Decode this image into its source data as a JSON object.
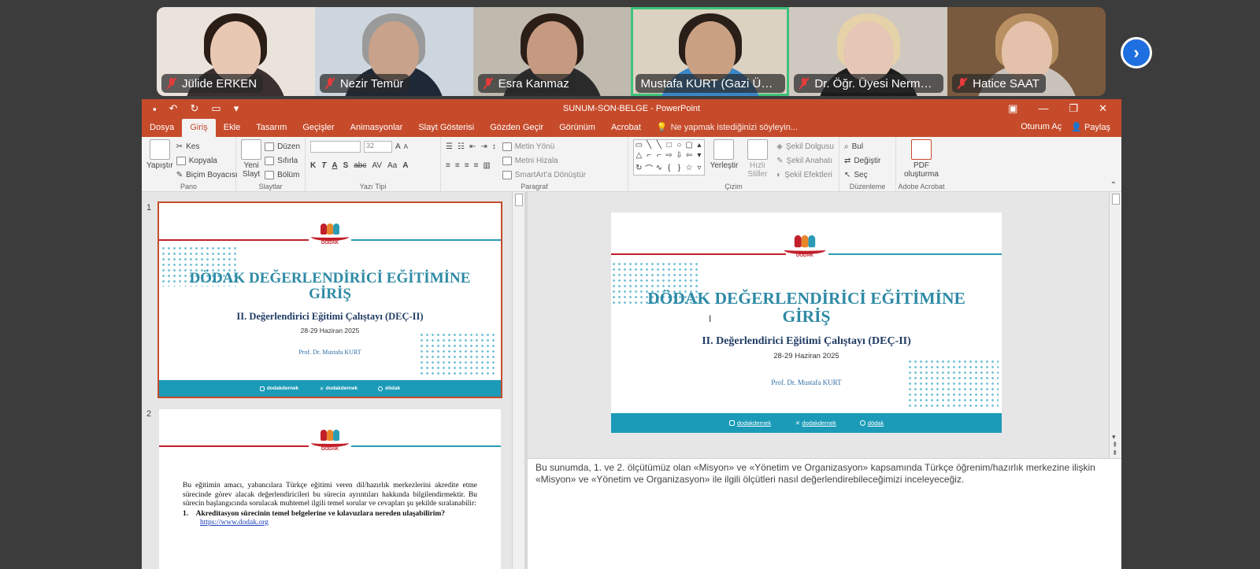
{
  "participants": [
    {
      "name": "Jülide ERKEN",
      "bg": "#e9e3dc",
      "skin": "#e8c7b3",
      "hair": "#2a1d16",
      "shirt": "#3c2f2f",
      "active": false
    },
    {
      "name": "Nezir Temür",
      "bg": "#cdd6de",
      "skin": "#c8a28a",
      "hair": "#9a9a9a",
      "shirt": "#1f2836",
      "active": false
    },
    {
      "name": "Esra Kanmaz",
      "bg": "#bfb9ae",
      "skin": "#c59a80",
      "hair": "#2b1e17",
      "shirt": "#2b2b2b",
      "active": false
    },
    {
      "name": "Mustafa KURT (Gazi Üniversitesi)",
      "bg": "#dcd2c2",
      "skin": "#caa083",
      "hair": "#2a1f18",
      "shirt": "#3a86c6",
      "active": true
    },
    {
      "name": "Dr. Öğr. Üyesi Nerma Özdemir",
      "bg": "#cfc8c0",
      "skin": "#e6c6b4",
      "hair": "#e6d2a8",
      "shirt": "#1b1b1b",
      "active": false
    },
    {
      "name": "Hatice SAAT",
      "bg": "#7a5a3e",
      "skin": "#e3c1aa",
      "hair": "#b99062",
      "shirt": "#c9c3bb",
      "active": false
    }
  ],
  "window": {
    "title": "SUNUM-SON-BELGE - PowerPoint",
    "tabs": [
      "Dosya",
      "Giriş",
      "Ekle",
      "Tasarım",
      "Geçişler",
      "Animasyonlar",
      "Slayt Gösterisi",
      "Gözden Geçir",
      "Görünüm",
      "Acrobat"
    ],
    "active_tab": "Giriş",
    "tell_me": "Ne yapmak istediğinizi söyleyin...",
    "sign_in": "Oturum Aç",
    "share": "Paylaş"
  },
  "ribbon": {
    "pano": {
      "label": "Pano",
      "paste": "Yapıştır",
      "cut": "Kes",
      "copy": "Kopyala",
      "format_painter": "Biçim Boyacısı"
    },
    "slaytlar": {
      "label": "Slaytlar",
      "new_slide_1": "Yeni",
      "new_slide_2": "Slayt",
      "layout": "Düzen",
      "reset": "Sıfırla",
      "section": "Bölüm"
    },
    "yazi_tipi": {
      "label": "Yazı Tipi",
      "font_size": "32",
      "bold": "K",
      "italic": "T",
      "underline": "A",
      "shadow": "S",
      "strike": "abc",
      "spacing": "AV",
      "case": "Aa",
      "color": "A",
      "grow": "A",
      "shrink": "A"
    },
    "paragraf": {
      "label": "Paragraf",
      "text_direction": "Metin Yönü",
      "align_text": "Metni Hizala",
      "smartart": "SmartArt'a Dönüştür"
    },
    "cizim": {
      "label": "Çizim",
      "arrange": "Yerleştir",
      "quick_styles_1": "Hızlı",
      "quick_styles_2": "Stiller",
      "fill": "Şekil Dolgusu",
      "outline": "Şekil Anahatı",
      "effects": "Şekil Efektleri"
    },
    "duzenleme": {
      "label": "Düzenleme",
      "find": "Bul",
      "replace": "Değiştir",
      "select": "Seç"
    },
    "acrobat": {
      "label": "Adobe Acrobat",
      "pdf_1": "PDF",
      "pdf_2": "oluşturma"
    }
  },
  "slide1": {
    "number": "1",
    "title_line1": "DÖDAK DEĞERLENDİRİCİ EĞİTİMİNE",
    "title_line2": "GİRİŞ",
    "subtitle": "II. Değerlendirici Eğitimi Çalıştayı (DEÇ-II)",
    "date": "28-29 Haziran 2025",
    "author": "Prof. Dr. Mustafa KURT",
    "logo_text": "DÖDAK",
    "social": [
      "dodakdernek",
      "dodakdernek",
      "dödak"
    ]
  },
  "slide2": {
    "number": "2",
    "body": "Bu eğitimin amacı, yabancılara Türkçe eğitimi veren dil/hazırlık merkezlerini akredite etme sürecinde görev alacak değerlendiricileri bu sürecin ayrıntıları hakkında bilgilendirmektir. Bu sürecin başlangıcında sorulacak muhtemel ilgili temel sorular ve cevapları şu şekilde sıralanabilir:",
    "item_num": "1.",
    "item": "Akreditasyon sürecinin temel belgelerine ve kılavuzlara nereden ulaşabilirim?",
    "link": "https://www.dodak.org"
  },
  "notes": "Bu sunumda, 1. ve 2. ölçütümüz olan «Misyon» ve «Yönetim ve Organizasyon» kapsamında Türkçe öğrenim/hazırlık merkezine ilişkin «Misyon» ve «Yönetim ve Organizasyon» ile ilgili ölçütleri nasıl değerlendirebileceğimizi inceleyeceğiz.",
  "colors": {
    "accent": "#c64b2b",
    "teal": "#1b9bb8",
    "title_teal": "#2e8aa5",
    "red": "#c2202b",
    "active_border": "#3ec27a"
  },
  "icons": {
    "next": "chevron-right-icon",
    "mic": "mic-off-icon"
  }
}
